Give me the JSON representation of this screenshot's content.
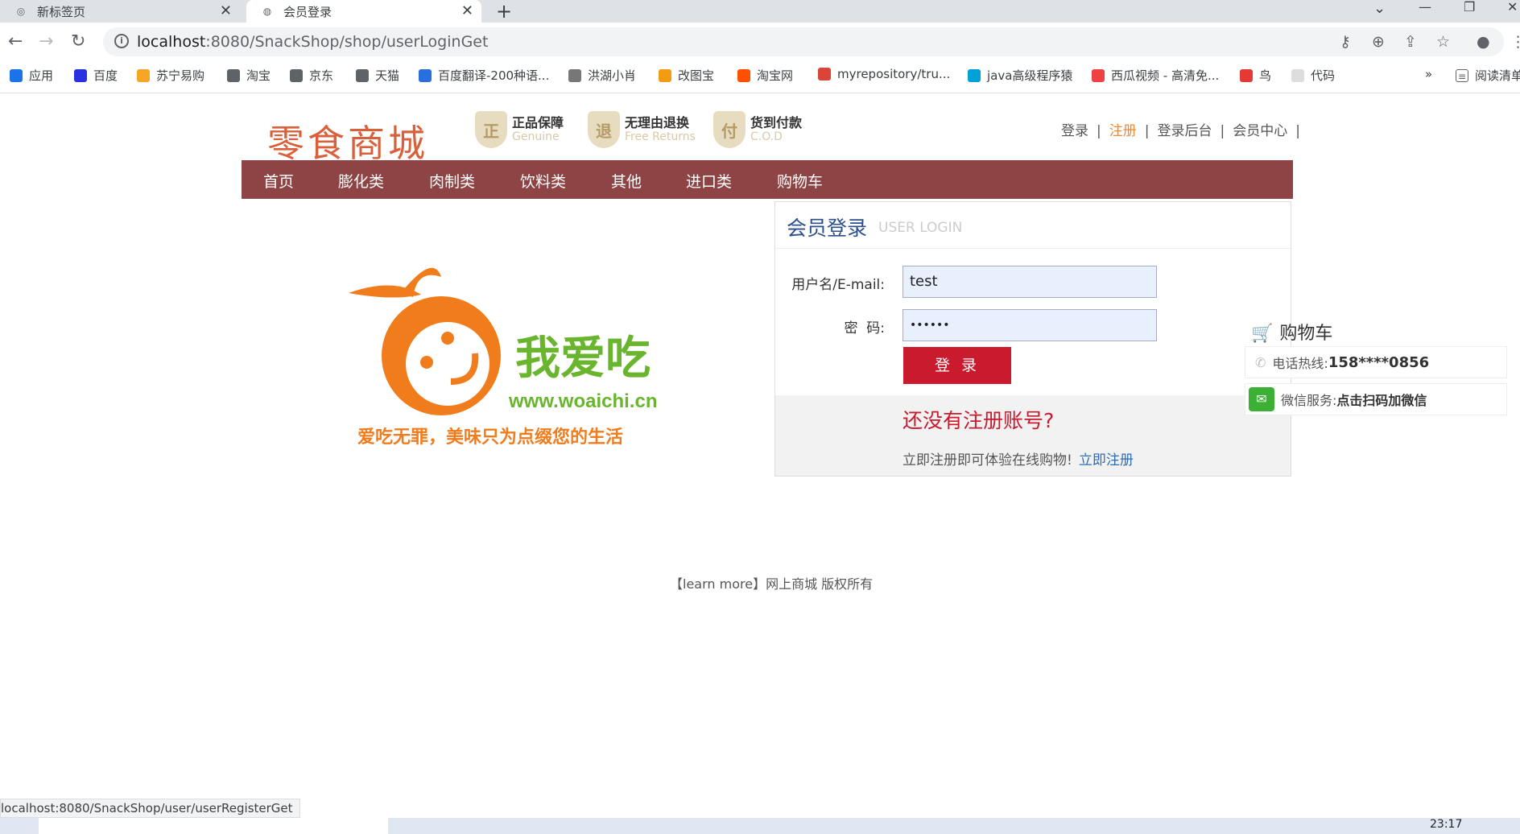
{
  "browser": {
    "tabs": [
      {
        "title": "新标签页"
      },
      {
        "title": "会员登录"
      }
    ],
    "url_host": "localhost",
    "url_path": ":8080/SnackShop/shop/userLoginGet",
    "bookmarks": [
      {
        "label": "应用",
        "color": "#1a73e8"
      },
      {
        "label": "百度",
        "color": "#2932e1"
      },
      {
        "label": "苏宁易购",
        "color": "#f5a623"
      },
      {
        "label": "淘宝",
        "color": "#5f6368"
      },
      {
        "label": "京东",
        "color": "#5f6368"
      },
      {
        "label": "天猫",
        "color": "#5f6368"
      },
      {
        "label": "百度翻译-200种语...",
        "color": "#2a6fe0"
      },
      {
        "label": "洪湖小肖",
        "color": "#777"
      },
      {
        "label": "改图宝",
        "color": "#f39c12"
      },
      {
        "label": "淘宝网",
        "color": "#ff5000"
      },
      {
        "label": "myrepository/tru...",
        "color": "#db4437"
      },
      {
        "label": "java高级程序猿",
        "color": "#00a1d6"
      },
      {
        "label": "西瓜视频 - 高清免...",
        "color": "#f04142"
      },
      {
        "label": "鸟",
        "color": "#e53935"
      },
      {
        "label": "代码",
        "color": "#ddd"
      }
    ],
    "more": "»",
    "reading_list": "阅读清单",
    "status_url": "localhost:8080/SnackShop/user/userRegisterGet",
    "clock": "23:17"
  },
  "site": {
    "logo": "零食商城",
    "badges": [
      {
        "title": "正品保障",
        "sub": "Genuine",
        "glyph": "正"
      },
      {
        "title": "无理由退换",
        "sub": "Free Returns",
        "glyph": "退"
      },
      {
        "title": "货到付款",
        "sub": "C.O.D",
        "glyph": "付"
      }
    ],
    "toplinks": {
      "login": "登录",
      "register": "注册",
      "admin": "登录后台",
      "member": "会员中心",
      "sep": "|"
    },
    "nav": [
      "首页",
      "膨化类",
      "肉制类",
      "饮料类",
      "其他",
      "进口类",
      "购物车"
    ],
    "mascot": {
      "brand": "我爱吃",
      "url": "www.woaichi.cn",
      "slogan": "爱吃无罪，美味只为点缀您的生活"
    },
    "login": {
      "title": "会员登录",
      "subtitle": "USER LOGIN",
      "username_label": "用户名/E-mail:",
      "username_value": "test",
      "password_label": "密  码:",
      "password_value": "••••••",
      "submit": "登 录",
      "no_account": "还没有注册账号?",
      "register_hint": "立即注册即可体验在线购物!",
      "register_link": "立即注册"
    },
    "side": {
      "cart": "购物车",
      "hotline_label": "电话热线: ",
      "hotline": "158****0856",
      "wechat_label": "微信服务: ",
      "wechat": "点击扫码加微信"
    },
    "copyright": "【learn more】网上商城 版权所有"
  }
}
